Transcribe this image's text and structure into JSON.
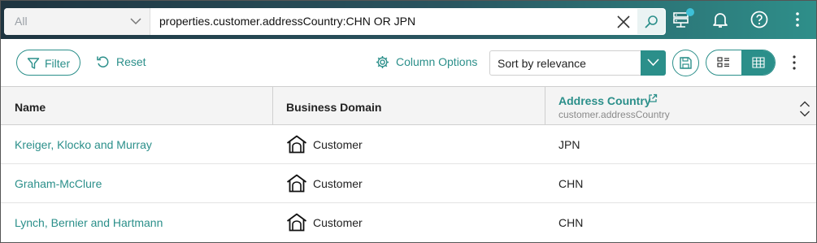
{
  "search": {
    "scope_label": "All",
    "query": "properties.customer.addressCountry:CHN OR JPN"
  },
  "toolbar": {
    "filter_label": "Filter",
    "reset_label": "Reset",
    "column_options_label": "Column Options",
    "sort_value": "Sort by relevance"
  },
  "table": {
    "columns": [
      {
        "label": "Name"
      },
      {
        "label": "Business Domain"
      },
      {
        "label": "Address Country",
        "sublabel": "customer.addressCountry"
      }
    ],
    "rows": [
      {
        "name": "Kreiger, Klocko and Murray",
        "domain": "Customer",
        "country": "JPN"
      },
      {
        "name": "Graham-McClure",
        "domain": "Customer",
        "country": "CHN"
      },
      {
        "name": "Lynch, Bernier and Hartmann",
        "domain": "Customer",
        "country": "CHN"
      }
    ]
  },
  "colors": {
    "accent": "#2b8f8a",
    "topbar_dark": "#1e3440",
    "notification_dot": "#3ec0d8"
  },
  "icons": [
    "chevron-down-icon",
    "clear-icon",
    "search-icon",
    "server-icon",
    "bell-icon",
    "help-icon",
    "more-vertical-icon",
    "filter-icon",
    "reset-icon",
    "gear-icon",
    "save-icon",
    "list-view-icon",
    "grid-view-icon",
    "external-link-icon",
    "sort-arrows-icon",
    "house-icon"
  ]
}
